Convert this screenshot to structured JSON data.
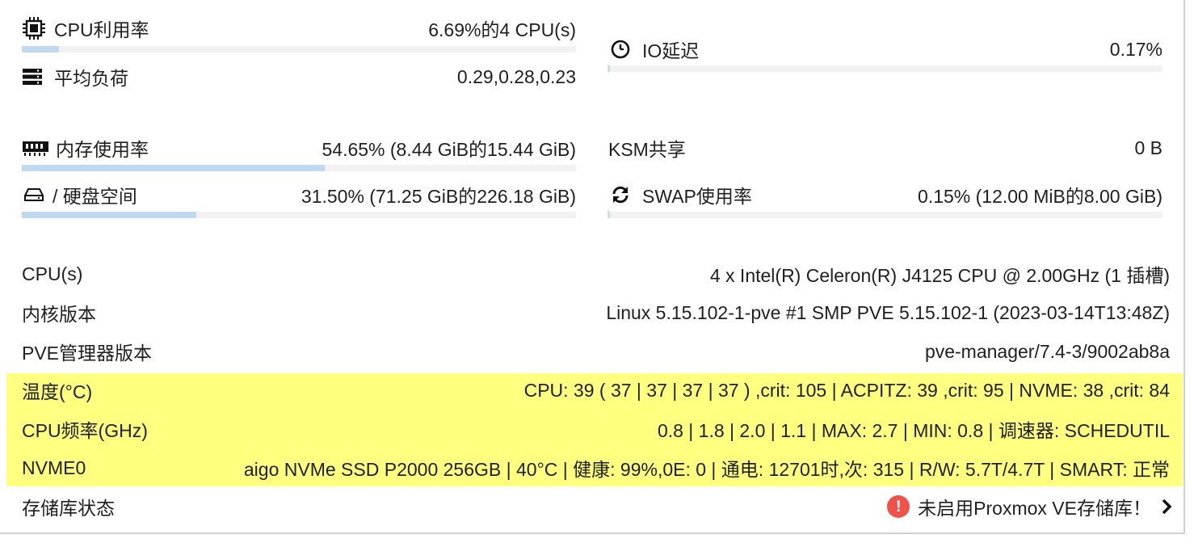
{
  "cpu": {
    "label": "CPU利用率",
    "value": "6.69%的4 CPU(s)",
    "percent": 6.69
  },
  "load": {
    "label": "平均负荷",
    "value": "0.29,0.28,0.23"
  },
  "io": {
    "label": "IO延迟",
    "value": "0.17%",
    "percent": 0.17
  },
  "memory": {
    "label": "内存使用率",
    "value": "54.65% (8.44 GiB的15.44 GiB)",
    "percent": 54.65
  },
  "ksm": {
    "label": "KSM共享",
    "value": "0 B"
  },
  "disk": {
    "label": "/ 硬盘空间",
    "value": "31.50% (71.25 GiB的226.18 GiB)",
    "percent": 31.5
  },
  "swap": {
    "label": "SWAP使用率",
    "value": "0.15% (12.00 MiB的8.00 GiB)",
    "percent": 0.15
  },
  "info": [
    {
      "label": "CPU(s)",
      "value": "4 x Intel(R) Celeron(R) J4125 CPU @ 2.00GHz (1 插槽)"
    },
    {
      "label": "内核版本",
      "value": "Linux 5.15.102-1-pve #1 SMP PVE 5.15.102-1 (2023-03-14T13:48Z)"
    },
    {
      "label": "PVE管理器版本",
      "value": "pve-manager/7.4-3/9002ab8a"
    },
    {
      "label": "温度(°C)",
      "value": "CPU: 39 ( 37 | 37 | 37 | 37 ) ,crit: 105 | ACPITZ: 39 ,crit: 95 | NVME: 38 ,crit: 84"
    },
    {
      "label": "CPU频率(GHz)",
      "value": "0.8 | 1.8 | 2.0 | 1.1 | MAX: 2.7 | MIN: 0.8 | 调速器: SCHEDUTIL"
    },
    {
      "label": "NVME0",
      "value": "aigo NVMe SSD P2000 256GB | 40°C | 健康: 99%,0E: 0 | 通电: 12701时,次: 315 | R/W: 5.7T/4.7T | SMART: 正常"
    }
  ],
  "storage": {
    "label": "存储库状态",
    "value": "未启用Proxmox VE存储库！"
  },
  "colors": {
    "highlight": "#ffff80",
    "bar_fill": "#c0d9ee",
    "bar_bg": "#f2f2f2",
    "warning": "#f0524a"
  },
  "icons": [
    "cpu-chip-icon",
    "server-stack-icon",
    "clock-icon",
    "memory-icon",
    "hard-drive-icon",
    "refresh-icon",
    "exclamation-circle-icon",
    "chevron-right-icon"
  ]
}
